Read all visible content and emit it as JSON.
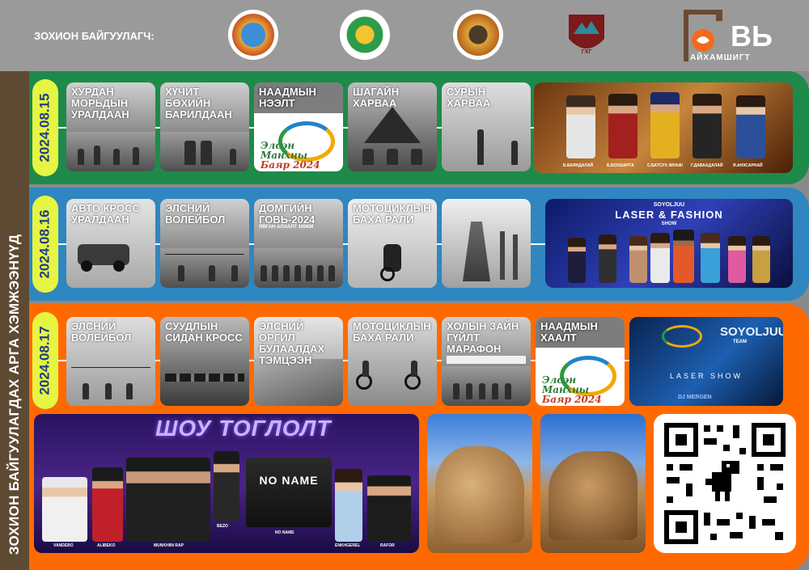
{
  "header": {
    "organizers_label": "ЗОХИОН БАЙГУУЛАГЧ:",
    "brand_text": "ВЬ",
    "brand_sub": "АЙХАМШИГТ"
  },
  "side_title": "ЗОХИОН БАЙГУУЛАГДАХ АРГА ХЭМЖЭЭНҮҮД",
  "day1": {
    "date": "2024.08.15",
    "cards": [
      "ХУРДАН МОРЬДЫН УРАЛДААН",
      "ХҮЧИТ БӨХИЙН БАРИЛДААН",
      "НААДМЫН НЭЭЛТ",
      "ШАГАЙН ХАРВАА",
      "СУРЫН ХАРВАА"
    ],
    "naadam_logo": [
      "Элсэн",
      "Манхны",
      "Баяр",
      "2024"
    ],
    "performers": [
      "Б.БАЯНДАЛАЙ",
      "Б.БОХШАРГА",
      "С.БАТСУХ /МУАЖ/",
      "Г.ДАВААДАЛАЙ",
      "Я.АНХСАРНАЙ"
    ]
  },
  "day2": {
    "date": "2024.08.16",
    "cards": [
      "АВТО КРОСС УРАЛДААН",
      "ЭЛСНИЙ ВОЛЕЙБОЛ",
      "ДОМГИЙН ГОВЬ-2024",
      "МОТОЦИКЛЫН БАХА РАЛИ",
      ""
    ],
    "card3_sub": "ЯВГАН АЛХАЛТ 100КМ",
    "show_title": "LASER & FASHION",
    "show_top": "SOYOLJUU",
    "show_sub": "SHOW"
  },
  "day3": {
    "date": "2024.08.17",
    "cards": [
      "ЭЛСНИЙ ВОЛЕЙБОЛ",
      "СУУДЛЫН СИДАН КРОСС",
      "ЭЛСНИЙ ОРГИЛ БУЛААЛДАХ ТЭМЦЭЭН",
      "МОТОЦИКЛЫН БАХА РАЛИ",
      "ХОЛЫН ЗАЙН ГҮЙЛТ МАРАФОН",
      "НААДМЫН ХААЛТ"
    ],
    "laser_brand": "SOYOLJUU",
    "laser_team": "TEAM",
    "laser_show": "LASER SHOW",
    "dj": "DJ MERGEN"
  },
  "show": {
    "title": "ШОУ ТОГЛОЛТ",
    "band_name": "NO NAME",
    "artists": [
      "VANDEBO",
      "ALIBEKO",
      "MUNKHIIN RAP",
      "BEZO",
      "NO NAME",
      "ENKHGEREL",
      "RAFOR"
    ]
  },
  "colors": {
    "day1": "#1e8a4a",
    "day2": "#2f86c0",
    "day3": "#ff6a00",
    "date_pill": "#e6f542"
  }
}
